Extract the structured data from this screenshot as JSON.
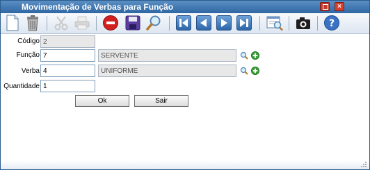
{
  "window": {
    "title": "Movimentação de Verbas para Função"
  },
  "toolbar": {
    "buttons": [
      "new-document-icon",
      "trash-icon",
      "cut-icon",
      "print-icon",
      "cancel-icon",
      "save-icon",
      "search-icon",
      "first-record-icon",
      "previous-record-icon",
      "next-record-icon",
      "last-record-icon",
      "preview-icon",
      "camera-icon",
      "help-icon"
    ]
  },
  "form": {
    "codigo": {
      "label": "Código",
      "value": "2"
    },
    "funcao": {
      "label": "Função",
      "value": "7",
      "description": "SERVENTE"
    },
    "verba": {
      "label": "Verba",
      "value": "4",
      "description": "UNIFORME"
    },
    "quantidade": {
      "label": "Quantidade",
      "value": "1"
    }
  },
  "buttons": {
    "ok": "Ok",
    "sair": "Sair"
  },
  "colors": {
    "titlebar": "#2f67a3",
    "accent": "#2d65a8",
    "cancel": "#d21f1f",
    "add": "#3aa33a"
  }
}
